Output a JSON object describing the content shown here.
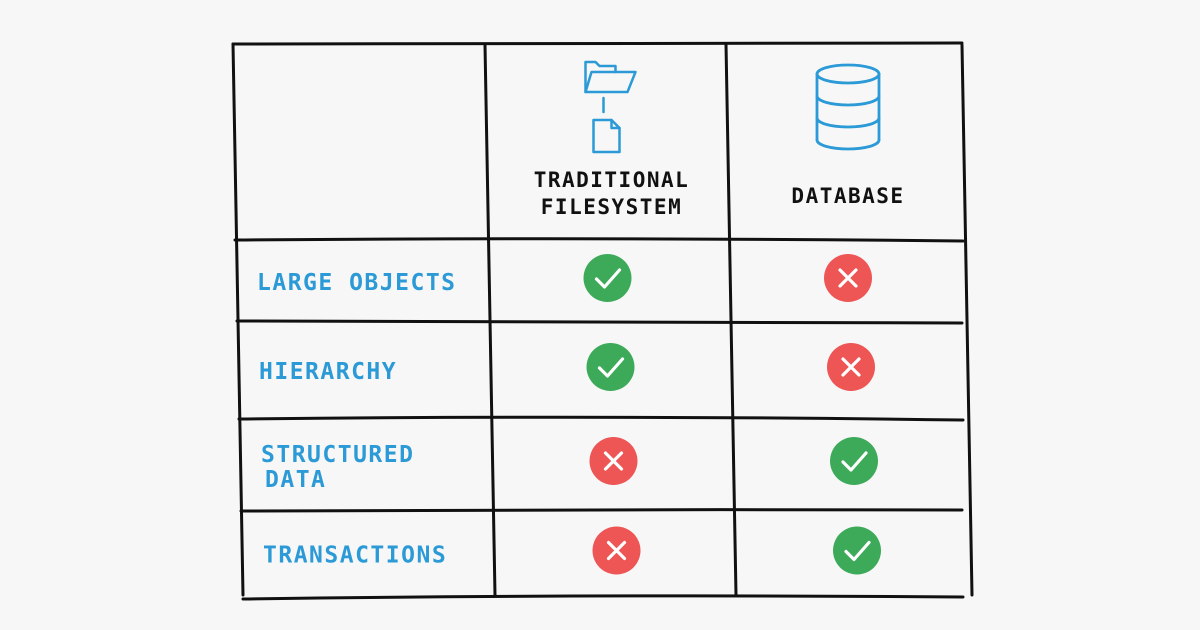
{
  "columns": [
    {
      "label_lines": [
        "Traditional",
        "Filesystem"
      ],
      "icon": "folder-file-icon"
    },
    {
      "label_lines": [
        "Database"
      ],
      "icon": "database-icon"
    }
  ],
  "rows": [
    {
      "label_lines": [
        "Large Objects"
      ],
      "values": [
        true,
        false
      ]
    },
    {
      "label_lines": [
        "Hierarchy"
      ],
      "values": [
        true,
        false
      ]
    },
    {
      "label_lines": [
        "Structured",
        "Data"
      ],
      "values": [
        false,
        true
      ]
    },
    {
      "label_lines": [
        "Transactions"
      ],
      "values": [
        false,
        true
      ]
    }
  ],
  "colors": {
    "line": "#111111",
    "label": "#2b9ad6",
    "icon": "#2b9ad6",
    "check_bg": "#3daa5a",
    "cross_bg": "#ee5555",
    "mark": "#ffffff",
    "background": "#f7f7f7"
  }
}
